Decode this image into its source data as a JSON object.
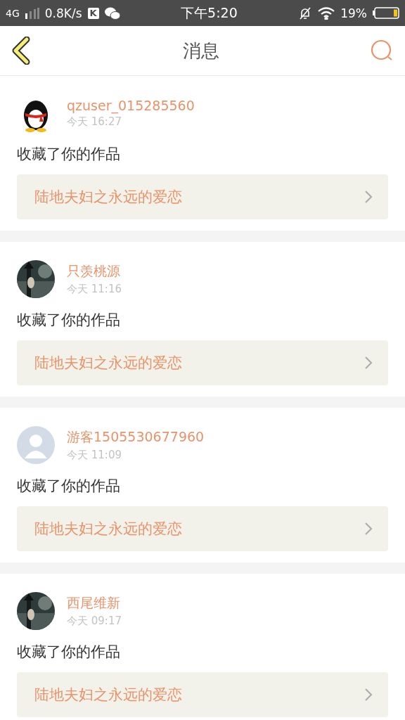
{
  "status_bar": {
    "network": "4G",
    "speed": "0.8K/s",
    "app_badge": "K",
    "time": "下午5:20",
    "battery": "19%"
  },
  "header": {
    "title": "消息"
  },
  "messages": [
    {
      "kind": "penguin",
      "name": "qzuser_015285560",
      "time": "今天 16:27",
      "text": "收藏了你的作品",
      "work": "陆地夫妇之永远的爱恋"
    },
    {
      "kind": "picture",
      "name": "只羡桃源",
      "time": "今天 11:16",
      "text": "收藏了你的作品",
      "work": "陆地夫妇之永远的爱恋"
    },
    {
      "kind": "default",
      "name": "游客1505530677960",
      "time": "今天 11:09",
      "text": "收藏了你的作品",
      "work": "陆地夫妇之永远的爱恋"
    },
    {
      "kind": "picture",
      "name": "西尾维新",
      "time": "今天 09:17",
      "text": "收藏了你的作品",
      "work": "陆地夫妇之永远的爱恋"
    }
  ]
}
